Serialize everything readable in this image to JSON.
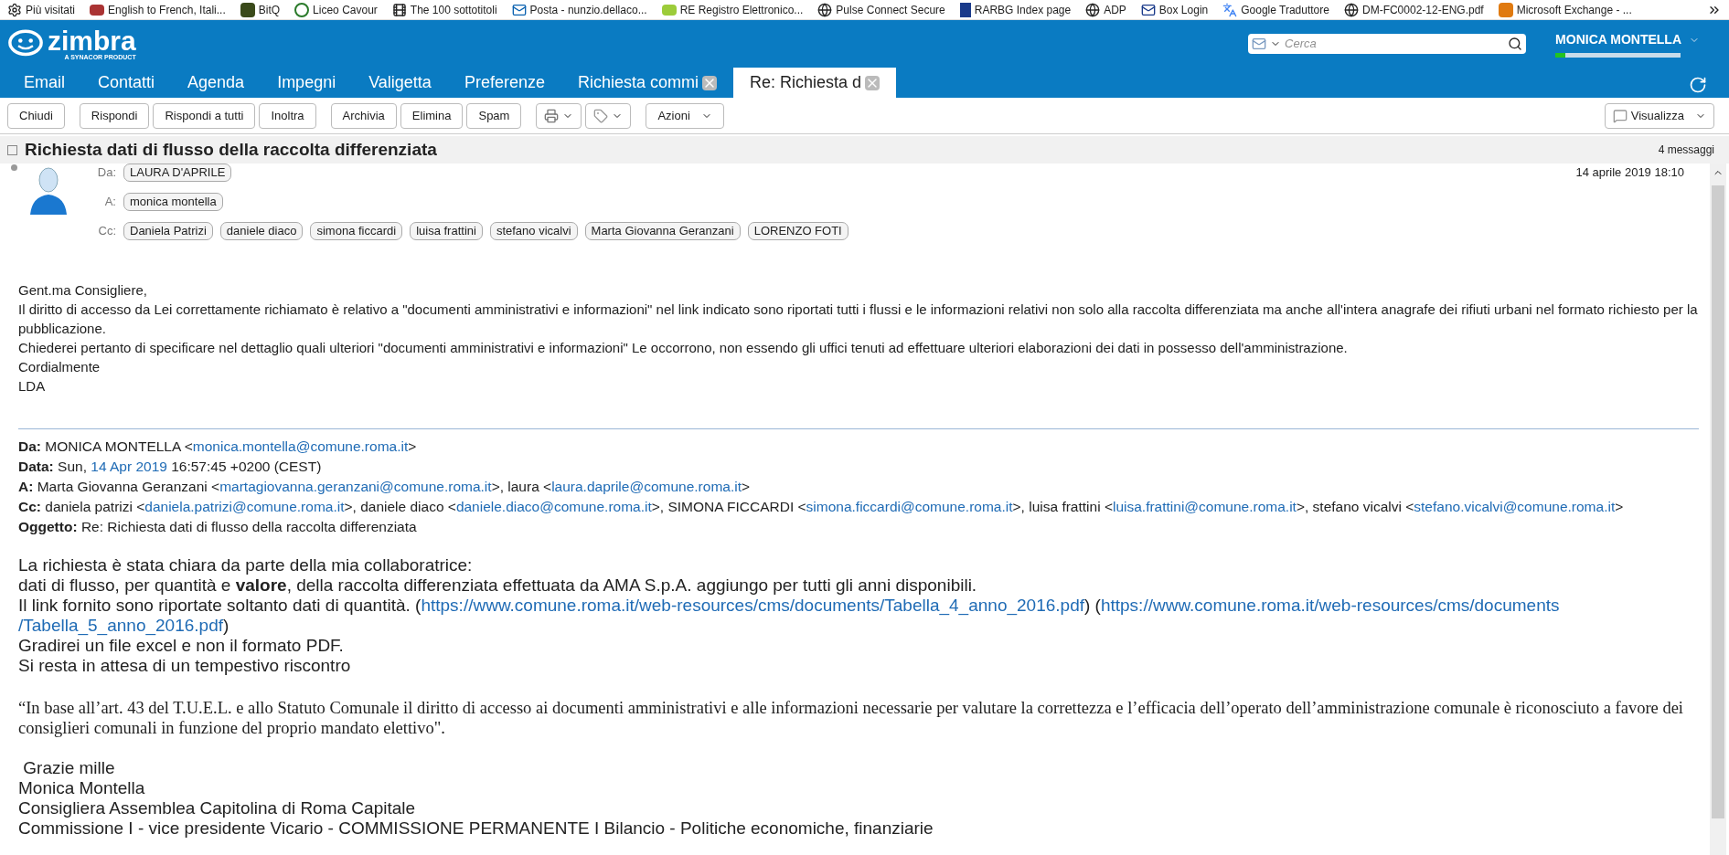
{
  "bookmarks": [
    {
      "label": "Più visitati",
      "kind": "gear"
    },
    {
      "label": "English to French, Itali...",
      "kind": "wr"
    },
    {
      "label": "BitQ",
      "kind": "square"
    },
    {
      "label": "Liceo Cavour",
      "kind": "emblem"
    },
    {
      "label": "The 100 sottotitoli",
      "kind": "film"
    },
    {
      "label": "Posta - nunzio.dellaco...",
      "kind": "mail"
    },
    {
      "label": "RE Registro Elettronico...",
      "kind": "re"
    },
    {
      "label": "Pulse Connect Secure",
      "kind": "globe"
    },
    {
      "label": "RARBG Index page",
      "kind": "r"
    },
    {
      "label": "ADP",
      "kind": "globe"
    },
    {
      "label": "Box Login",
      "kind": "envelope"
    },
    {
      "label": "Google Traduttore",
      "kind": "translate"
    },
    {
      "label": "DM-FC0002-12-ENG.pdf",
      "kind": "globe"
    },
    {
      "label": "Microsoft Exchange - ...",
      "kind": "office"
    }
  ],
  "header": {
    "logo": {
      "name": "zimbra",
      "tagline": "A SYNACOR PRODUCT"
    },
    "search": {
      "placeholder": "Cerca"
    },
    "user": "MONICA MONTELLA",
    "quota": {
      "level": 0.08
    }
  },
  "tabs": [
    {
      "label": "Email",
      "selected": false,
      "closable": false
    },
    {
      "label": "Contatti",
      "selected": false,
      "closable": false
    },
    {
      "label": "Agenda",
      "selected": false,
      "closable": false
    },
    {
      "label": "Impegni",
      "selected": false,
      "closable": false
    },
    {
      "label": "Valigetta",
      "selected": false,
      "closable": false
    },
    {
      "label": "Preferenze",
      "selected": false,
      "closable": false
    },
    {
      "label": "Richiesta commi",
      "selected": false,
      "closable": true
    },
    {
      "label": "Re: Richiesta d",
      "selected": true,
      "closable": true
    }
  ],
  "toolbar": {
    "groups": [
      [
        "Chiudi"
      ],
      [
        "Rispondi",
        "Rispondi a tutti",
        "Inoltra"
      ],
      [
        "Archivia",
        "Elimina",
        "Spam"
      ]
    ],
    "menus": [
      {
        "kind": "print"
      },
      {
        "kind": "tag"
      },
      {
        "kind": "text",
        "label": "Azioni"
      }
    ],
    "view": "Visualizza"
  },
  "conversation": {
    "subject": "Richiesta dati di flusso della raccolta differenziata",
    "count": "4 messaggi"
  },
  "message": {
    "date": "14 aprile 2019 18:10",
    "fields": [
      {
        "label": "Da:",
        "people": [
          "LAURA D'APRILE"
        ]
      },
      {
        "label": "A:",
        "people": [
          "monica montella"
        ]
      },
      {
        "label": "Cc:",
        "people": [
          "Daniela Patrizi",
          "daniele diaco",
          "simona ficcardi",
          "luisa frattini",
          "stefano vicalvi",
          "Marta Giovanna Geranzani",
          "LORENZO FOTI"
        ]
      }
    ],
    "body": [
      "Gent.ma Consigliere,",
      "Il diritto di accesso da Lei correttamente richiamato è relativo a \"documenti amministrativi e informazioni\" nel link indicato sono riportati tutti i flussi e le informazioni relativi non solo alla raccolta differenziata ma anche all'intera anagrafe dei rifiuti urbani nel formato richiesto per la pubblicazione.",
      "Chiederei pertanto di specificare nel dettaglio quali ulteriori \"documenti amministrativi e informazioni\" Le occorrono, non essendo gli uffici tenuti ad effettuare ulteriori elaborazioni dei dati in possesso dell'amministrazione.",
      "Cordialmente",
      "LDA"
    ],
    "quoted_header": [
      {
        "label": "Da:",
        "parts": [
          {
            "text": "MONICA MONTELLA <",
            "link": false
          },
          {
            "text": "monica.montella@comune.roma.it",
            "link": true
          },
          {
            "text": ">",
            "link": false
          }
        ]
      },
      {
        "label": "Data:",
        "parts": [
          {
            "text": "Sun, ",
            "link": false
          },
          {
            "text": "14 Apr 2019",
            "link": true
          },
          {
            "text": " 16:57:45 +0200 (CEST)",
            "link": false
          }
        ]
      },
      {
        "label": "A:",
        "parts": [
          {
            "text": "Marta Giovanna Geranzani <",
            "link": false
          },
          {
            "text": "martagiovanna.geranzani@comune.roma.it",
            "link": true
          },
          {
            "text": ">, laura <",
            "link": false
          },
          {
            "text": "laura.daprile@comune.roma.it",
            "link": true
          },
          {
            "text": ">",
            "link": false
          }
        ]
      },
      {
        "label": "Cc:",
        "parts": [
          {
            "text": "daniela patrizi <",
            "link": false
          },
          {
            "text": "daniela.patrizi@comune.roma.it",
            "link": true
          },
          {
            "text": ">, daniele diaco <",
            "link": false
          },
          {
            "text": "daniele.diaco@comune.roma.it",
            "link": true
          },
          {
            "text": ">, SIMONA FICCARDI <",
            "link": false
          },
          {
            "text": "simona.ficcardi@comune.roma.it",
            "link": true
          },
          {
            "text": ">, luisa frattini <",
            "link": false
          },
          {
            "text": "luisa.frattini@comune.roma.it",
            "link": true
          },
          {
            "text": ">, stefano vicalvi <",
            "link": false
          },
          {
            "text": "stefano.vicalvi@comune.roma.it",
            "link": true
          },
          {
            "text": ">",
            "link": false
          }
        ]
      },
      {
        "label": "Oggetto:",
        "parts": [
          {
            "text": "Re: Richiesta dati di flusso della raccolta differenziata",
            "link": false
          }
        ]
      }
    ],
    "reply": [
      {
        "parts": [
          {
            "text": "La richiesta è stata chiara da parte della mia collaboratrice:",
            "link": false
          }
        ]
      },
      {
        "parts": [
          {
            "text": "dati di flusso, per quantità e **valore**, della raccolta differenziata effettuata da AMA S.p.A. aggiungo per tutti gli anni disponibili.",
            "link": false
          }
        ]
      },
      {
        "parts": [
          {
            "text": "Il link fornito sono riportate soltanto dati di quantità. (",
            "link": false
          },
          {
            "text": "https://www.comune.roma.it/web-resources/cms/documents/Tabella_4_anno_2016.pdf",
            "link": true
          },
          {
            "text": ") (",
            "link": false
          },
          {
            "text": "https://www.comune.roma.it/web-resources/cms/documents",
            "link": true
          }
        ]
      },
      {
        "parts": [
          {
            "text": "/Tabella_5_anno_2016.pdf",
            "link": true
          },
          {
            "text": ")",
            "link": false
          }
        ]
      },
      {
        "parts": [
          {
            "text": "Gradirei un file excel e non il formato PDF.",
            "link": false
          }
        ]
      },
      {
        "parts": [
          {
            "text": "Si resta in attesa di un tempestivo riscontro",
            "link": false
          }
        ]
      }
    ],
    "quote": "“In base all’art. 43 del T.U.E.L. e allo Statuto Comunale il diritto di accesso ai documenti amministrativi e alle informazioni necessarie per valutare la correttezza e l’efficacia dell’operato dell’amministrazione comunale è riconosciuto a favore dei consiglieri comunali in funzione del proprio mandato elettivo\".",
    "signature": [
      " Grazie mille",
      "Monica Montella",
      "Consigliera Assemblea Capitolina di Roma Capitale",
      "Commissione I - vice presidente Vicario - COMMISSIONE PERMANENTE I Bilancio - Politiche economiche, finanziarie"
    ]
  }
}
